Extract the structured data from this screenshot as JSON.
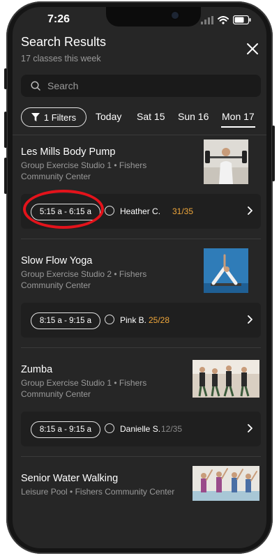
{
  "status_bar": {
    "time": "7:26"
  },
  "header": {
    "title": "Search Results",
    "subtitle": "17 classes this week"
  },
  "search": {
    "placeholder": "Search"
  },
  "filters": {
    "label": "1 Filters"
  },
  "day_tabs": [
    {
      "label": "Today"
    },
    {
      "label": "Sat 15"
    },
    {
      "label": "Sun 16"
    },
    {
      "label": "Mon 17",
      "active": true
    }
  ],
  "classes": [
    {
      "name": "Les Mills Body Pump",
      "location": "Group Exercise Studio 1 • Fishers Community Center",
      "session": {
        "time": "5:15 a - 6:15 a",
        "instructor": "Heather C.",
        "capacity": "31/35",
        "capacity_color": "#f0a73b"
      }
    },
    {
      "name": "Slow Flow Yoga",
      "location": "Group Exercise Studio 2 • Fishers Community Center",
      "session": {
        "time": "8:15 a - 9:15 a",
        "instructor": "Pink B.",
        "capacity": "25/28",
        "capacity_color": "#f0a73b"
      }
    },
    {
      "name": "Zumba",
      "location": "Group Exercise Studio 1 • Fishers Community Center",
      "session": {
        "time": "8:15 a - 9:15 a",
        "instructor": "Danielle S.",
        "capacity": "12/35",
        "capacity_color": "#8a8a8a"
      }
    },
    {
      "name": "Senior Water Walking",
      "location": "Leisure Pool • Fishers Community Center"
    }
  ],
  "colors": {
    "background": "#262626",
    "highlight_ring": "#e3131b",
    "capacity_warning": "#f0a73b",
    "capacity_normal": "#8a8a8a"
  },
  "icons": [
    "filter-icon",
    "search-icon",
    "close-icon",
    "chevron-right-icon",
    "signal-icon",
    "wifi-icon",
    "battery-icon"
  ]
}
